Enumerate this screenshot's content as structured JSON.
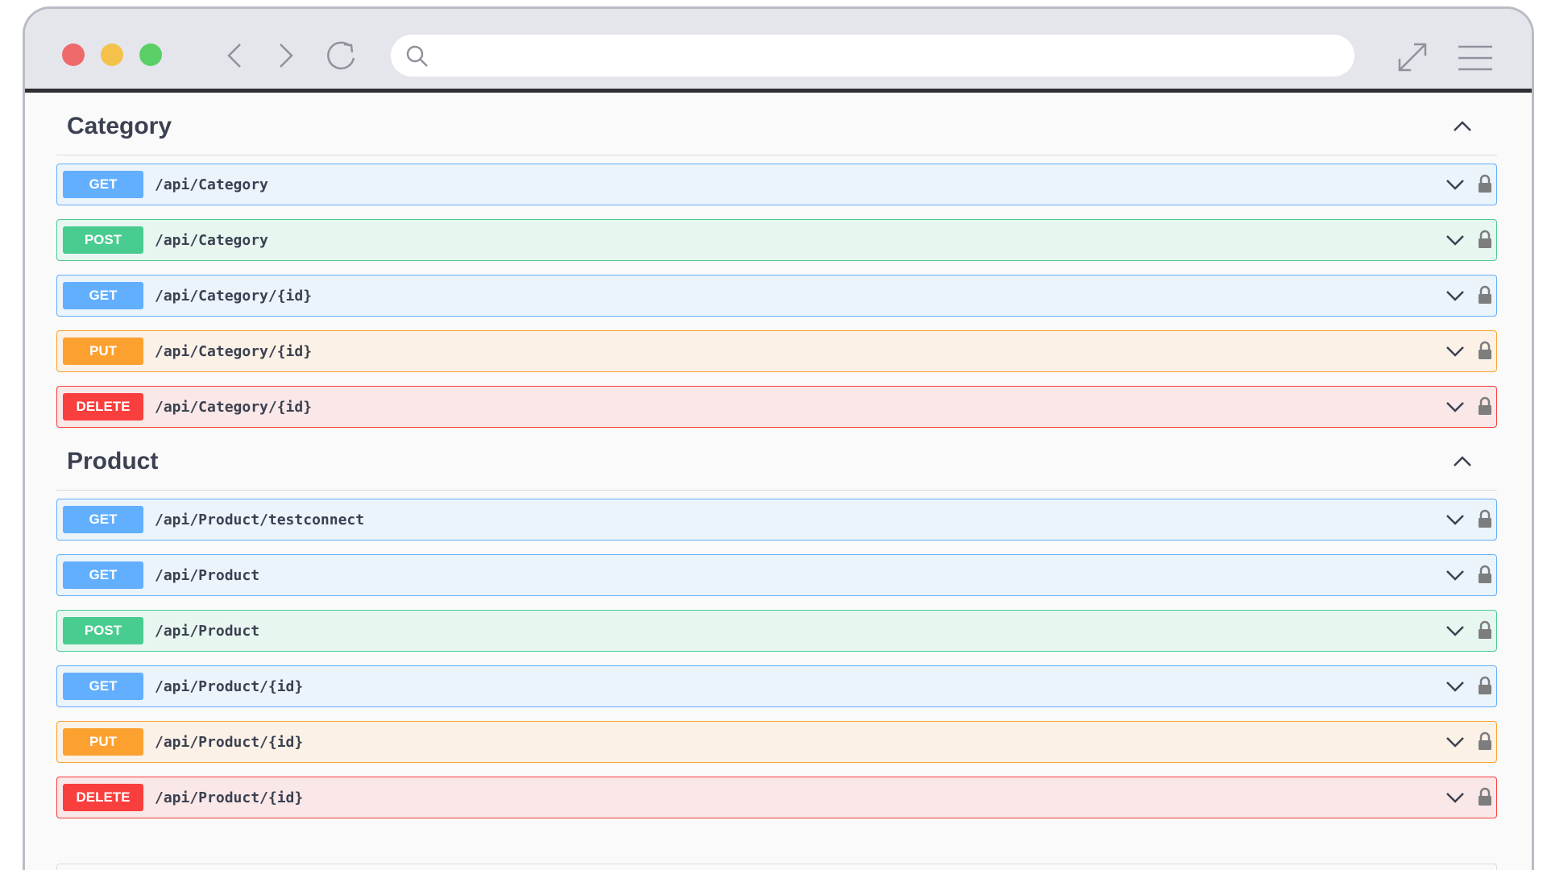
{
  "browser": {
    "address": {
      "value": "",
      "placeholder": ""
    },
    "icons": [
      "close-dot",
      "minimize-dot",
      "maximize-dot",
      "back-icon",
      "forward-icon",
      "reload-icon",
      "search-icon",
      "expand-icon",
      "hamburger-menu-icon"
    ],
    "colors": {
      "close": "#ee6a6a",
      "minimize": "#f4c14b",
      "maximize": "#59cf66",
      "toolbar": "#e4e6ec"
    }
  },
  "method_colors": {
    "GET": "#61affe",
    "POST": "#49cc90",
    "PUT": "#fca130",
    "DELETE": "#f93e3e"
  },
  "sections": [
    {
      "title": "Category",
      "operations": [
        {
          "method": "GET",
          "path": "/api/Category"
        },
        {
          "method": "POST",
          "path": "/api/Category"
        },
        {
          "method": "GET",
          "path": "/api/Category/{id}"
        },
        {
          "method": "PUT",
          "path": "/api/Category/{id}"
        },
        {
          "method": "DELETE",
          "path": "/api/Category/{id}"
        }
      ]
    },
    {
      "title": "Product",
      "operations": [
        {
          "method": "GET",
          "path": "/api/Product/testconnect"
        },
        {
          "method": "GET",
          "path": "/api/Product"
        },
        {
          "method": "POST",
          "path": "/api/Product"
        },
        {
          "method": "GET",
          "path": "/api/Product/{id}"
        },
        {
          "method": "PUT",
          "path": "/api/Product/{id}"
        },
        {
          "method": "DELETE",
          "path": "/api/Product/{id}"
        }
      ]
    }
  ]
}
